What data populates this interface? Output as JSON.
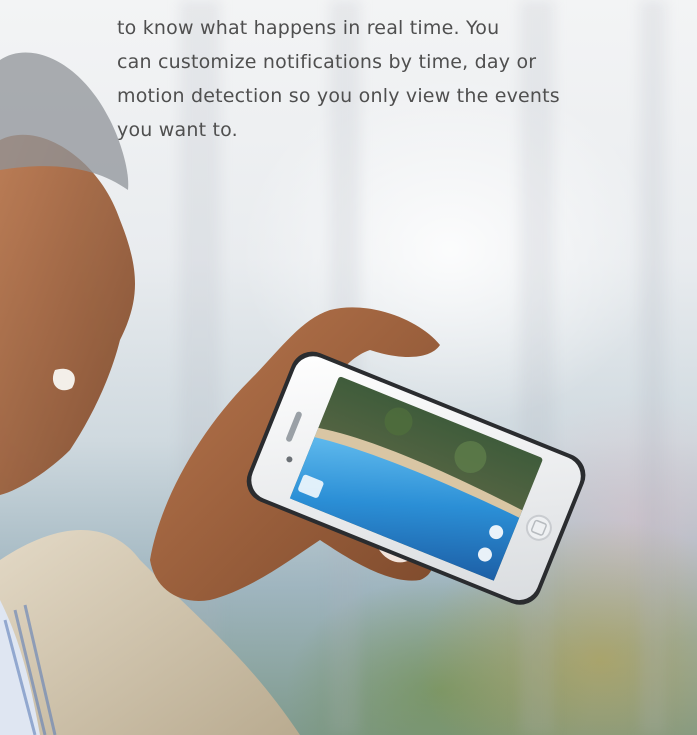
{
  "copy": {
    "lines": [
      "to know what happens in real time. You",
      "can customize notifications by time, day or",
      "motion detection so you only view the events",
      "you want to."
    ]
  },
  "colors": {
    "text": "#4f4f4f",
    "pool_water": "#2b8fd6",
    "phone_body": "#f4f5f6"
  }
}
